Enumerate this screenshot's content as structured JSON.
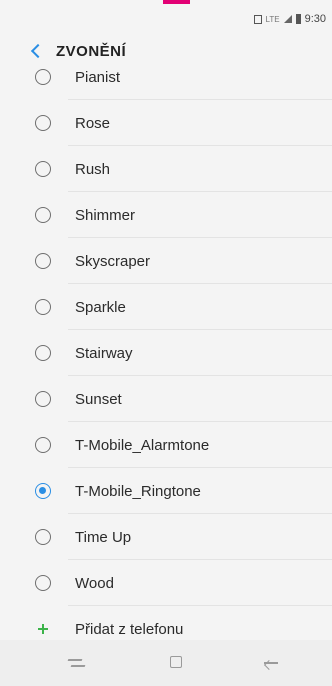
{
  "status": {
    "time": "9:30",
    "network": "LTE"
  },
  "header": {
    "title": "ZVONĚNÍ"
  },
  "ringtones": [
    {
      "label": "Pianist",
      "selected": false
    },
    {
      "label": "Rose",
      "selected": false
    },
    {
      "label": "Rush",
      "selected": false
    },
    {
      "label": "Shimmer",
      "selected": false
    },
    {
      "label": "Skyscraper",
      "selected": false
    },
    {
      "label": "Sparkle",
      "selected": false
    },
    {
      "label": "Stairway",
      "selected": false
    },
    {
      "label": "Sunset",
      "selected": false
    },
    {
      "label": "T-Mobile_Alarmtone",
      "selected": false
    },
    {
      "label": "T-Mobile_Ringtone",
      "selected": true
    },
    {
      "label": "Time Up",
      "selected": false
    },
    {
      "label": "Wood",
      "selected": false
    }
  ],
  "add_from_phone": {
    "label": "Přidat z telefonu"
  },
  "colors": {
    "accent": "#2a8ee4",
    "add": "#3cb34a",
    "brand": "#e20074"
  },
  "icons": {
    "back": "chevron-left-icon",
    "add": "plus-icon",
    "nav_recent": "recent-apps-icon",
    "nav_home": "home-icon",
    "nav_back": "back-arrow-icon"
  }
}
